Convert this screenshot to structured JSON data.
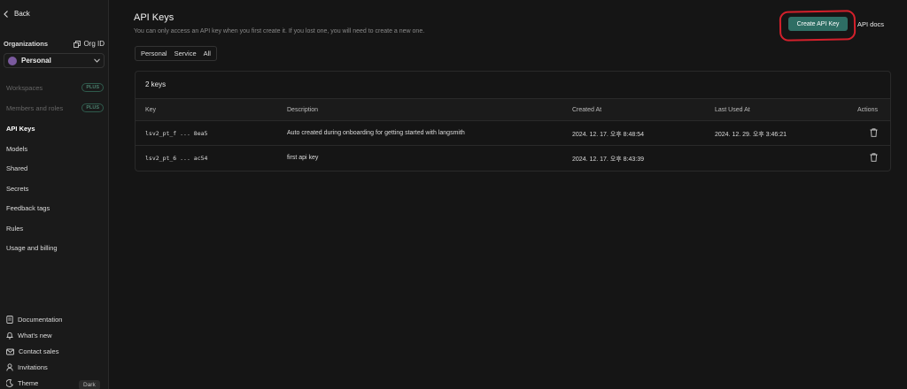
{
  "sidebar": {
    "back_label": "Back",
    "organizations_label": "Organizations",
    "org_id_label": "Org ID",
    "org_name": "Personal",
    "plus_badge": "PLUS",
    "items": [
      {
        "label": "Workspaces"
      },
      {
        "label": "Members and roles"
      },
      {
        "label": "API Keys"
      },
      {
        "label": "Models"
      },
      {
        "label": "Shared"
      },
      {
        "label": "Secrets"
      },
      {
        "label": "Feedback tags"
      },
      {
        "label": "Rules"
      },
      {
        "label": "Usage and billing"
      }
    ],
    "footer": [
      {
        "label": "Documentation"
      },
      {
        "label": "What's new"
      },
      {
        "label": "Contact sales"
      },
      {
        "label": "Invitations"
      },
      {
        "label": "Theme"
      }
    ],
    "theme_value": "Dark"
  },
  "main": {
    "title": "API Keys",
    "subtitle": "You can only access an API key when you first create it. If you lost one, you will need to create a new one.",
    "create_button": "Create API Key",
    "api_docs": "API docs",
    "tabs": [
      "Personal",
      "Service",
      "All"
    ],
    "count_label": "2 keys",
    "columns": [
      "Key",
      "Description",
      "Created At",
      "Last Used At",
      "Actions"
    ],
    "rows": [
      {
        "key": "lsv2_pt_f ... 8ea5",
        "description": "Auto created during onboarding for getting started with langsmith",
        "created": "2024. 12. 17. 오후 8:48:54",
        "last_used": "2024. 12. 29. 오후 3:46:21"
      },
      {
        "key": "lsv2_pt_6 ... ac54",
        "description": "first api key",
        "created": "2024. 12. 17. 오후 8:43:39",
        "last_used": ""
      }
    ]
  },
  "colors": {
    "accent": "#2e6e64",
    "annotation": "#d4202b",
    "background": "#151515"
  }
}
